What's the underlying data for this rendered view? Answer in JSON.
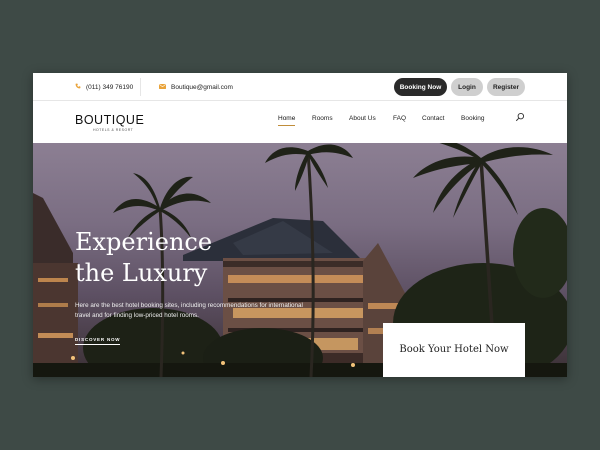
{
  "topbar": {
    "phone": "(011) 349 76190",
    "email": "Boutique@gmail.com",
    "booking_btn": "Booking Now",
    "login_btn": "Login",
    "register_btn": "Register"
  },
  "brand": {
    "name": "BOUTIQUE",
    "tagline": "HOTELS & RESORT"
  },
  "nav": {
    "items": [
      "Home",
      "Rooms",
      "About Us",
      "FAQ",
      "Contact",
      "Booking"
    ],
    "active": "Home"
  },
  "hero": {
    "title_line1": "Experience",
    "title_line2": "the Luxury",
    "description": "Here are the best hotel booking sites, including recommendations for international travel and for finding low-priced hotel rooms.",
    "cta": "DISCOVER NOW",
    "book_box": "Book Your Hotel Now"
  },
  "colors": {
    "page_bg": "#3e4a46",
    "accent": "#e9a33a",
    "dark_button": "#2a2a2a",
    "light_button": "#cfcfcf"
  },
  "icons": [
    "phone-icon",
    "mail-icon",
    "search-icon"
  ]
}
